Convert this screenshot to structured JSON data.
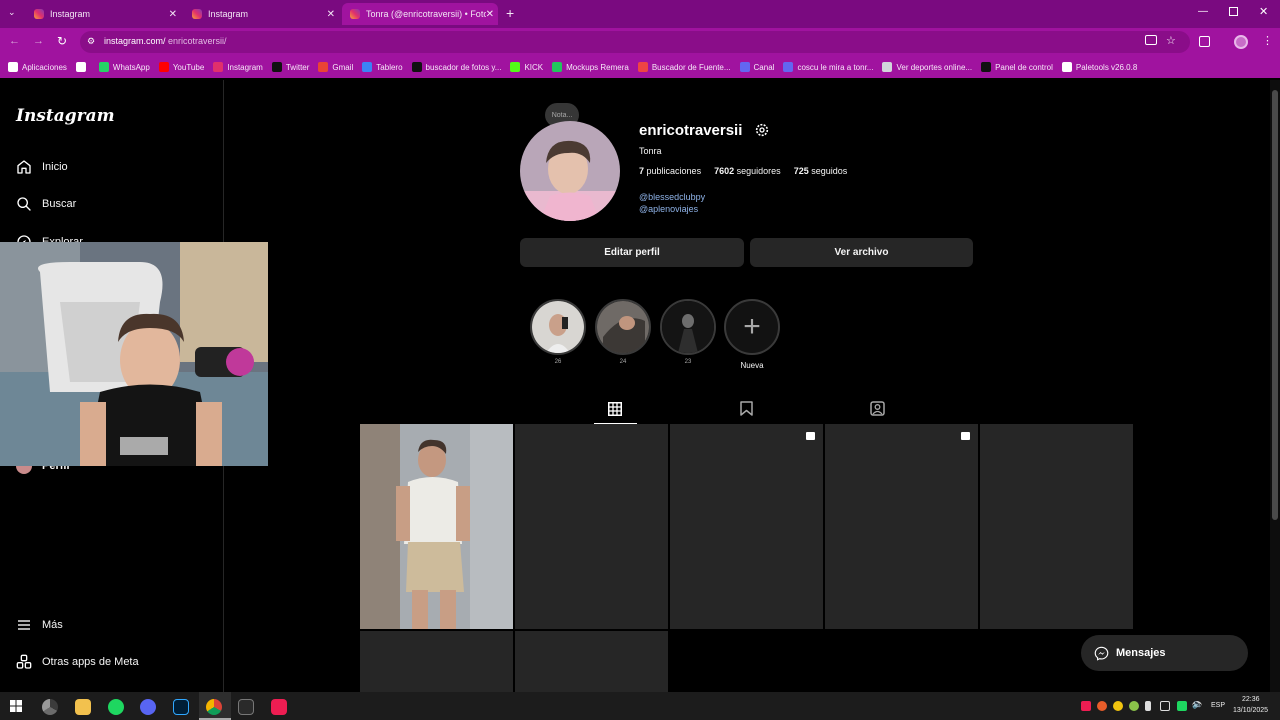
{
  "browser": {
    "tabs": [
      {
        "title": "Instagram",
        "active": false
      },
      {
        "title": "Instagram",
        "active": false
      },
      {
        "title": "Tonra (@enricotraversii) • Foto…",
        "active": true
      }
    ],
    "address": {
      "host": "instagram.com/",
      "path": "enricotraversii/"
    },
    "bookmarks": [
      {
        "label": "Aplicaciones",
        "icon": "apps-grid-icon",
        "color": "#ffffff"
      },
      {
        "label": "",
        "icon": "grid-icon",
        "color": "#ffffff"
      },
      {
        "label": "WhatsApp",
        "icon": "whatsapp-icon",
        "color": "#25d366"
      },
      {
        "label": "YouTube",
        "icon": "youtube-icon",
        "color": "#ff0000"
      },
      {
        "label": "Instagram",
        "icon": "instagram-icon",
        "color": "#e1306c"
      },
      {
        "label": "Twitter",
        "icon": "x-icon",
        "color": "#111111"
      },
      {
        "label": "Gmail",
        "icon": "gmail-icon",
        "color": "#ea4335"
      },
      {
        "label": "Tablero",
        "icon": "board-icon",
        "color": "#3b82f6"
      },
      {
        "label": "buscador de fotos y...",
        "icon": "pinterest-icon",
        "color": "#111111"
      },
      {
        "label": "KICK",
        "icon": "kick-icon",
        "color": "#53fc18"
      },
      {
        "label": "Mockups Remera",
        "icon": "mockup-icon",
        "color": "#22c55e"
      },
      {
        "label": "Buscador de Fuente...",
        "icon": "font-search-icon",
        "color": "#ef4444"
      },
      {
        "label": "Canal",
        "icon": "canal-icon",
        "color": "#6366f1"
      },
      {
        "label": "coscu le mira a tonr...",
        "icon": "coscu-icon",
        "color": "#6366f1"
      },
      {
        "label": "Ver deportes online...",
        "icon": "sports-icon",
        "color": "#d1d5db"
      },
      {
        "label": "Panel de control",
        "icon": "panel-icon",
        "color": "#111111"
      },
      {
        "label": "Paletools v26.0.8",
        "icon": "paletools-icon",
        "color": "#ffffff"
      }
    ]
  },
  "sidebar": {
    "logo": "Instagram",
    "items": [
      {
        "label": "Inicio",
        "icon": "home-icon"
      },
      {
        "label": "Buscar",
        "icon": "search-icon"
      },
      {
        "label": "Explorar",
        "icon": "explore-icon"
      },
      {
        "label": "Perfil",
        "icon": "profile-icon"
      }
    ],
    "bottom": [
      {
        "label": "Más",
        "icon": "menu-icon"
      },
      {
        "label": "Otras apps de Meta",
        "icon": "meta-apps-icon"
      }
    ]
  },
  "profile": {
    "note": "Nota...",
    "username": "enricotraversii",
    "name": "Tonra",
    "stats": {
      "posts_num": "7",
      "posts_label": "publicaciones",
      "followers_num": "7602",
      "followers_label": "seguidores",
      "following_num": "725",
      "following_label": "seguidos"
    },
    "links": [
      "@blessedclubpy",
      "@aplenoviajes"
    ],
    "buttons": {
      "edit": "Editar perfil",
      "archive": "Ver archivo"
    },
    "highlights": [
      {
        "label": "26"
      },
      {
        "label": "24"
      },
      {
        "label": "23"
      },
      {
        "label": "Nueva"
      }
    ]
  },
  "messages_button": {
    "label": "Mensajes"
  },
  "taskbar": {
    "lang": "ESP",
    "time": "22:36",
    "date": "13/10/2025"
  },
  "colors": {
    "browser_frame": "#a0139f",
    "tab_strip": "#7a0a80",
    "link": "#e0f1ff",
    "surface": "#262626"
  }
}
